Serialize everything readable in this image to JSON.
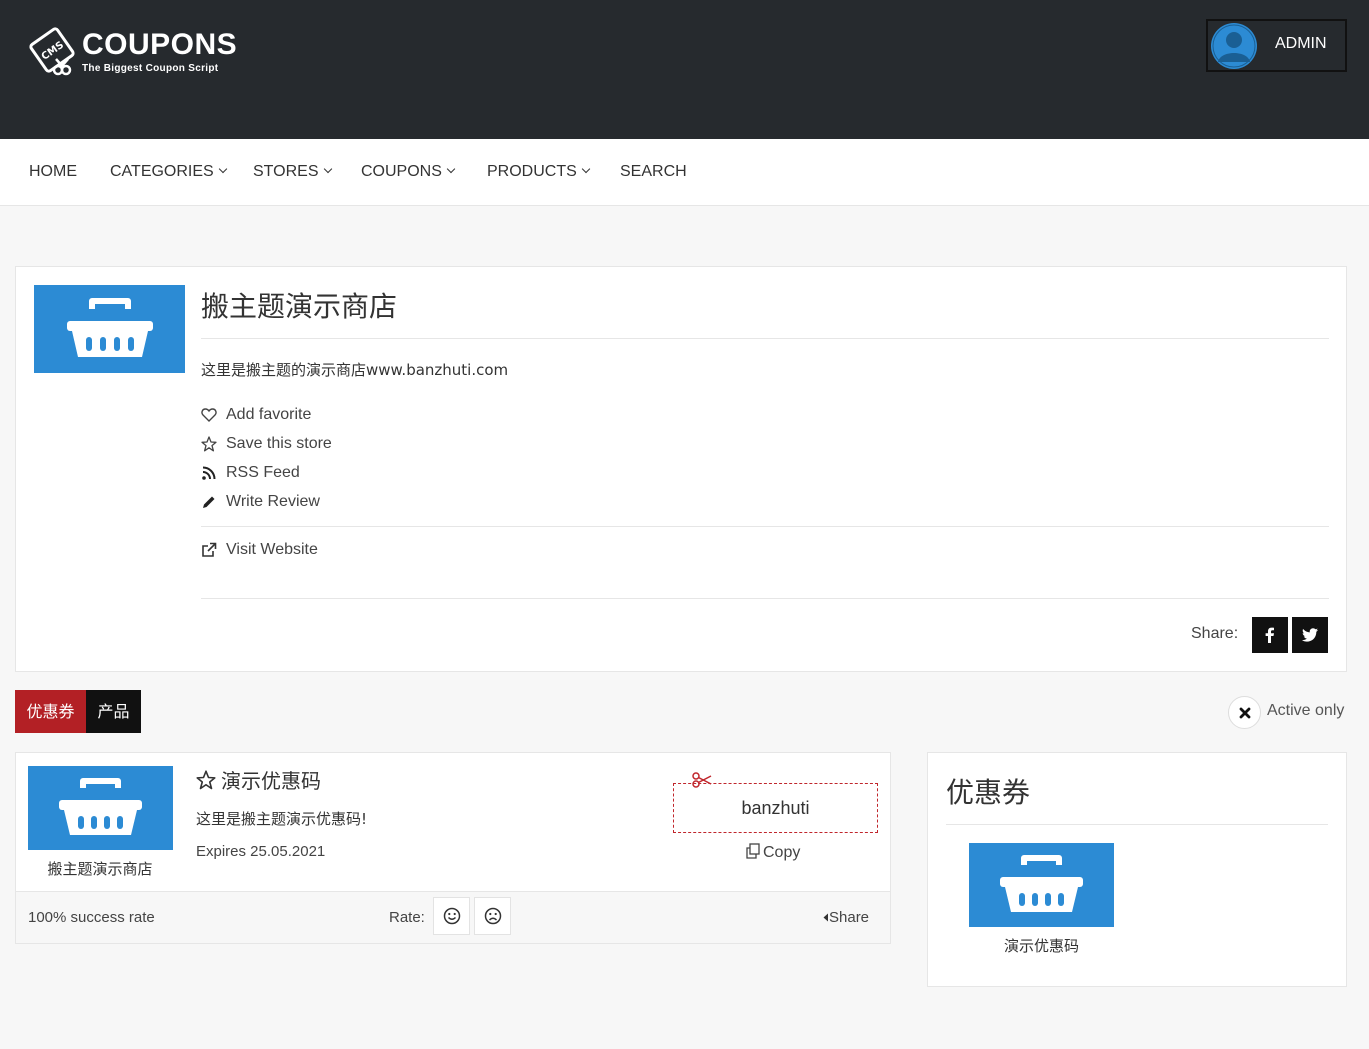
{
  "header": {
    "logo_title": "COUPONS",
    "logo_subtitle": "The Biggest Coupon Script",
    "logo_badge_text": "CMS",
    "user_label": "ADMIN"
  },
  "nav": {
    "items": [
      {
        "label": "HOME",
        "has_dropdown": false
      },
      {
        "label": "CATEGORIES",
        "has_dropdown": true
      },
      {
        "label": "STORES",
        "has_dropdown": true
      },
      {
        "label": "COUPONS",
        "has_dropdown": true
      },
      {
        "label": "PRODUCTS",
        "has_dropdown": true
      },
      {
        "label": "SEARCH",
        "has_dropdown": false
      }
    ]
  },
  "store": {
    "name": "搬主题演示商店",
    "description": "这里是搬主题的演示商店www.banzhuti.com",
    "logo_icon": "shopping-basket-icon",
    "actions": {
      "add_favorite": "Add favorite",
      "save_store": "Save this store",
      "rss_feed": "RSS Feed",
      "write_review": "Write Review",
      "visit_website": "Visit Website"
    },
    "share_label": "Share:"
  },
  "tabs": {
    "coupons": "优惠券",
    "products": "产品",
    "active_only": "Active only"
  },
  "coupon": {
    "title": "演示优惠码",
    "description": "这里是搬主题演示优惠码!",
    "expires": "Expires 25.05.2021",
    "store_name": "搬主题演示商店",
    "code": "banzhuti",
    "copy_label": "Copy",
    "success_rate": "100% success rate",
    "rate_label": "Rate:",
    "share_label": "Share"
  },
  "sidebar": {
    "title": "优惠券",
    "item_caption": "演示优惠码"
  },
  "colors": {
    "header_bg": "#262a2e",
    "brand_blue": "#2c8bd4",
    "accent_red": "#b32025",
    "dark": "#111111"
  }
}
